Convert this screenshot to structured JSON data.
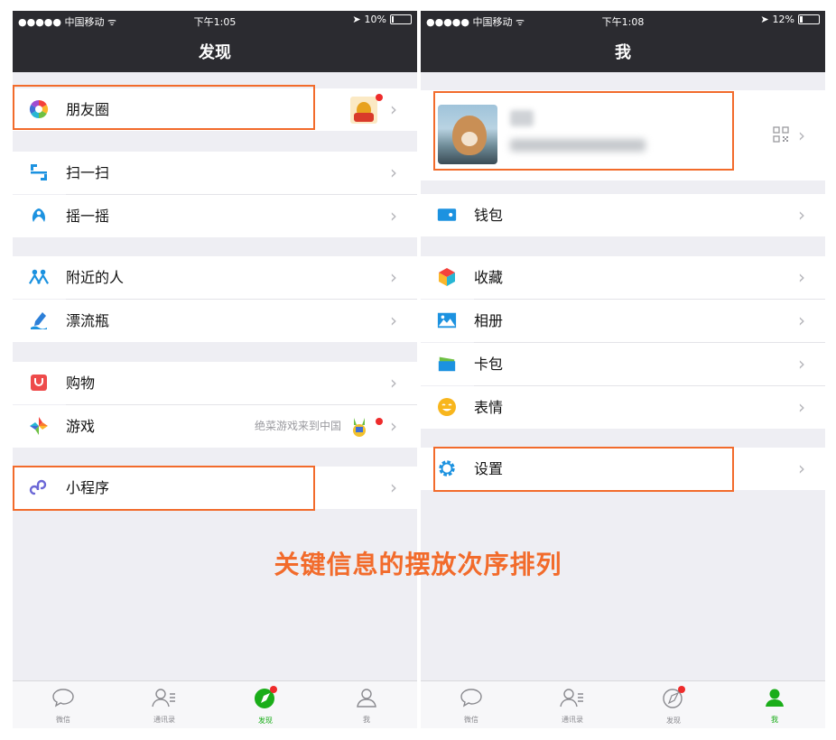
{
  "caption": "关键信息的摆放次序排列",
  "colors": {
    "accent": "#f26b2b",
    "wechat_green": "#1aad19",
    "nav_bg": "#2b2b30"
  },
  "left": {
    "status": {
      "carrier": "●●●●● 中国移动 ᯤ",
      "time": "下午1:05",
      "battery": "10%",
      "battery_level": 0.1
    },
    "title": "发现",
    "moments": {
      "label": "朋友圈",
      "icon": "moments-icon"
    },
    "scan": {
      "label": "扫一扫",
      "icon": "scan-icon"
    },
    "shake": {
      "label": "摇一摇",
      "icon": "shake-icon"
    },
    "nearby": {
      "label": "附近的人",
      "icon": "people-nearby-icon"
    },
    "bottle": {
      "label": "漂流瓶",
      "icon": "drift-bottle-icon"
    },
    "shopping": {
      "label": "购物",
      "icon": "shopping-icon"
    },
    "games": {
      "label": "游戏",
      "subtitle": "绝菜游戏来到中国",
      "icon": "games-icon"
    },
    "miniprogram": {
      "label": "小程序",
      "icon": "mini-program-icon"
    },
    "tabs": [
      {
        "label": "微信",
        "icon": "chat-bubble-icon"
      },
      {
        "label": "通讯录",
        "icon": "contacts-icon"
      },
      {
        "label": "发现",
        "icon": "compass-icon",
        "active": true
      },
      {
        "label": "我",
        "icon": "me-icon"
      }
    ]
  },
  "right": {
    "status": {
      "carrier": "●●●●● 中国移动 ᯤ",
      "time": "下午1:08",
      "battery": "12%",
      "battery_level": 0.12
    },
    "title": "我",
    "wallet": {
      "label": "钱包",
      "icon": "wallet-icon"
    },
    "favorites": {
      "label": "收藏",
      "icon": "favorites-icon"
    },
    "album": {
      "label": "相册",
      "icon": "album-icon"
    },
    "cards": {
      "label": "卡包",
      "icon": "card-wallet-icon"
    },
    "stickers": {
      "label": "表情",
      "icon": "emoji-icon"
    },
    "settings": {
      "label": "设置",
      "icon": "settings-icon"
    },
    "tabs": [
      {
        "label": "微信",
        "icon": "chat-bubble-icon"
      },
      {
        "label": "通讯录",
        "icon": "contacts-icon"
      },
      {
        "label": "发现",
        "icon": "compass-icon"
      },
      {
        "label": "我",
        "icon": "me-icon",
        "active": true
      }
    ]
  }
}
